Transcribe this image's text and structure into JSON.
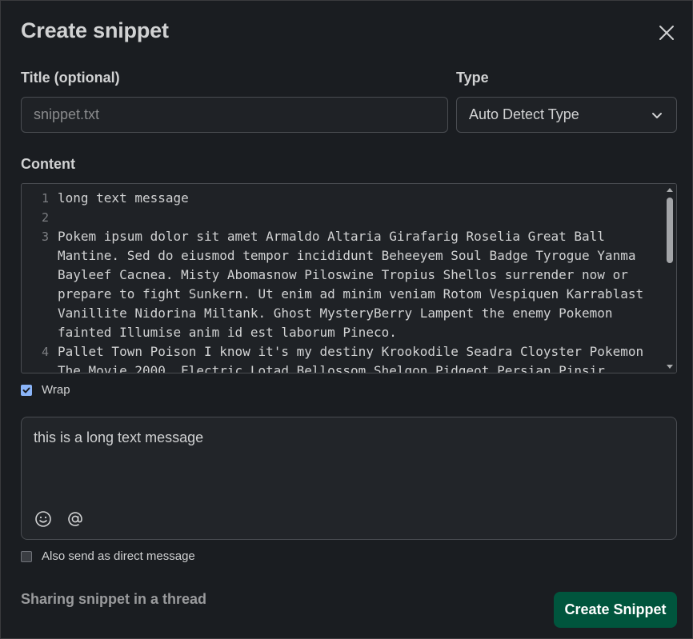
{
  "dialog": {
    "title": "Create snippet",
    "close_icon": "close-icon"
  },
  "title_field": {
    "label": "Title (optional)",
    "placeholder": "snippet.txt",
    "value": ""
  },
  "type_field": {
    "label": "Type",
    "selected": "Auto Detect Type",
    "icon": "chevron-down-icon"
  },
  "content": {
    "label": "Content",
    "lines": [
      {
        "number": "1",
        "text": "long text message"
      },
      {
        "number": "2",
        "text": ""
      },
      {
        "number": "3",
        "text": "Pokem ipsum dolor sit amet Armaldo Altaria Girafarig Roselia Great Ball Mantine. Sed do eiusmod tempor incididunt Beheeyem Soul Badge Tyrogue Yanma Bayleef Cacnea. Misty Abomasnow Piloswine Tropius Shellos surrender now or prepare to fight Sunkern. Ut enim ad minim veniam Rotom Vespiquen Karrablast Vanillite Nidorina Miltank. Ghost MysteryBerry Lampent the enemy Pokemon fainted Illumise anim id est laborum Pineco."
      },
      {
        "number": "4",
        "text": "Pallet Town Poison I know it's my destiny Krookodile Seadra Cloyster Pokemon The Movie 2000. Electric Lotad Bellossom Shelgon Pidgeot Persian Pinsir."
      }
    ]
  },
  "wrap": {
    "label": "Wrap",
    "checked": true
  },
  "message": {
    "text": "this is a long text message",
    "icons": [
      "emoji-icon",
      "mention-icon"
    ]
  },
  "direct_message": {
    "label": "Also send as direct message",
    "checked": false
  },
  "footer": {
    "context": "Sharing snippet in a thread",
    "create_label": "Create Snippet"
  },
  "colors": {
    "background": "#1a1d21",
    "primary_button": "#00553d",
    "checkbox_checked": "#8ab4f8"
  }
}
